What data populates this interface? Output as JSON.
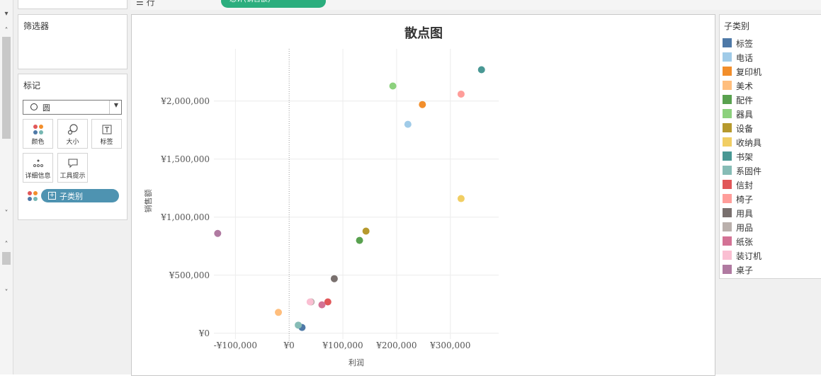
{
  "filters": {
    "title": "筛选器"
  },
  "marks": {
    "title": "标记",
    "mark_type": "圆",
    "buttons": [
      {
        "label": "颜色",
        "icon": "color-dots-icon"
      },
      {
        "label": "大小",
        "icon": "size-icon"
      },
      {
        "label": "标签",
        "icon": "label-icon"
      },
      {
        "label": "详细信息",
        "icon": "detail-icon"
      },
      {
        "label": "工具提示",
        "icon": "tooltip-icon"
      }
    ],
    "pill": "子类别"
  },
  "shelf": {
    "rows_label": "行",
    "rows_pill": "总计(销售额)"
  },
  "legend": {
    "title": "子类别",
    "items": [
      {
        "name": "标签",
        "color": "#4e79a7"
      },
      {
        "name": "电话",
        "color": "#a0cbe8"
      },
      {
        "name": "复印机",
        "color": "#f28e2b"
      },
      {
        "name": "美术",
        "color": "#ffbe7d"
      },
      {
        "name": "配件",
        "color": "#59a14f"
      },
      {
        "name": "器具",
        "color": "#8cd17d"
      },
      {
        "name": "设备",
        "color": "#b6992d"
      },
      {
        "name": "收纳具",
        "color": "#f1ce63"
      },
      {
        "name": "书架",
        "color": "#499894"
      },
      {
        "name": "系固件",
        "color": "#86bcb6"
      },
      {
        "name": "信封",
        "color": "#e15759"
      },
      {
        "name": "椅子",
        "color": "#ff9d9a"
      },
      {
        "name": "用具",
        "color": "#79706e"
      },
      {
        "name": "用品",
        "color": "#bab0ac"
      },
      {
        "name": "纸张",
        "color": "#d37295"
      },
      {
        "name": "装订机",
        "color": "#fabfd2"
      },
      {
        "name": "桌子",
        "color": "#b07aa1"
      }
    ]
  },
  "chart_data": {
    "type": "scatter",
    "title": "散点图",
    "xlabel": "利润",
    "ylabel": "销售额",
    "xlim": [
      -140000,
      390000
    ],
    "ylim": [
      -50000,
      2450000
    ],
    "x_ticks": [
      {
        "value": -100000,
        "label": "-¥100,000"
      },
      {
        "value": 0,
        "label": "¥0"
      },
      {
        "value": 100000,
        "label": "¥100,000"
      },
      {
        "value": 200000,
        "label": "¥200,000"
      },
      {
        "value": 300000,
        "label": "¥300,000"
      }
    ],
    "y_ticks": [
      {
        "value": 0,
        "label": "¥0"
      },
      {
        "value": 500000,
        "label": "¥500,000"
      },
      {
        "value": 1000000,
        "label": "¥1,000,000"
      },
      {
        "value": 1500000,
        "label": "¥1,500,000"
      },
      {
        "value": 2000000,
        "label": "¥2,000,000"
      }
    ],
    "grid": true,
    "points": [
      {
        "name": "标签",
        "x": 24000,
        "y": 50000
      },
      {
        "name": "电话",
        "x": 221000,
        "y": 1800000
      },
      {
        "name": "复印机",
        "x": 248000,
        "y": 1970000
      },
      {
        "name": "美术",
        "x": -20000,
        "y": 180000
      },
      {
        "name": "配件",
        "x": 131000,
        "y": 800000
      },
      {
        "name": "器具",
        "x": 193000,
        "y": 2130000
      },
      {
        "name": "设备",
        "x": 143000,
        "y": 880000
      },
      {
        "name": "收纳具",
        "x": 320000,
        "y": 1160000
      },
      {
        "name": "书架",
        "x": 358000,
        "y": 2270000
      },
      {
        "name": "系固件",
        "x": 17000,
        "y": 70000
      },
      {
        "name": "信封",
        "x": 72000,
        "y": 270000
      },
      {
        "name": "椅子",
        "x": 320000,
        "y": 2060000
      },
      {
        "name": "用具",
        "x": 84000,
        "y": 470000
      },
      {
        "name": "用品",
        "x": 41000,
        "y": 270000
      },
      {
        "name": "纸张",
        "x": 61000,
        "y": 245000
      },
      {
        "name": "装订机",
        "x": 39000,
        "y": 270000
      },
      {
        "name": "桌子",
        "x": -133000,
        "y": 860000
      }
    ]
  }
}
